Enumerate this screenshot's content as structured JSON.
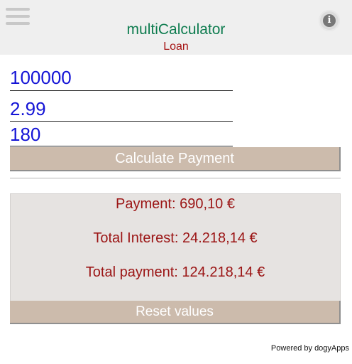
{
  "header": {
    "title": "multiCalculator",
    "subtitle": "Loan",
    "menu_icon": "hamburger-menu-icon",
    "info_icon": "info-icon",
    "info_glyph": "i"
  },
  "inputs": {
    "amount": "100000",
    "rate": "2.99",
    "term": "180"
  },
  "buttons": {
    "calculate": "Calculate Payment",
    "reset": "Reset values"
  },
  "results": {
    "payment": "Payment: 690,10 €",
    "total_interest": "Total Interest: 24.218,14 €",
    "total_payment": "Total payment: 124.218,14 €"
  },
  "footer": {
    "powered_by": "Powered by dogyApps"
  },
  "colors": {
    "title": "#0e7c4f",
    "subtitle": "#a51313",
    "input_text": "#1414d6",
    "button_bg": "#ccbbac",
    "result_text": "#9b1414",
    "result_bg": "#e6e3e1"
  }
}
